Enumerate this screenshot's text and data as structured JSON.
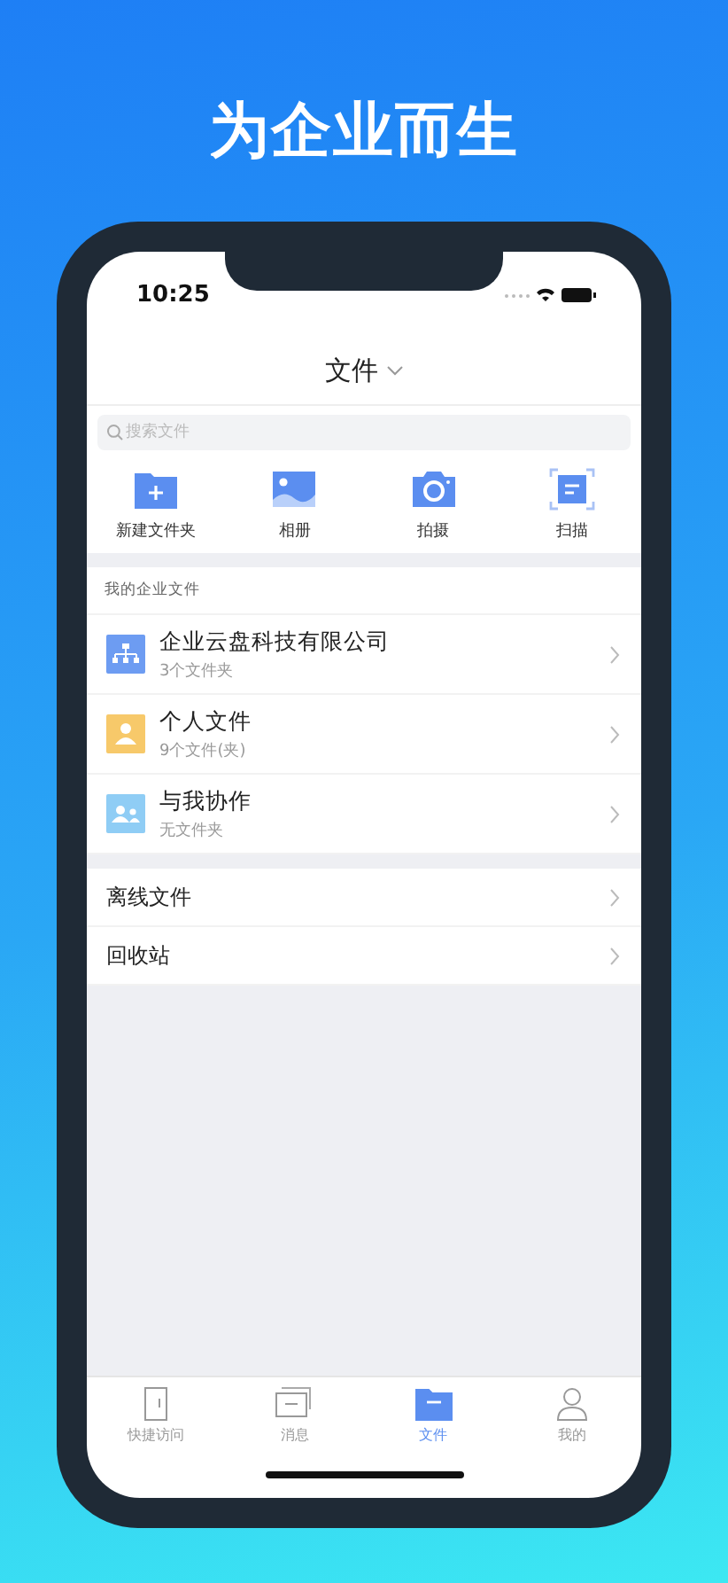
{
  "headline": "为企业而生",
  "status_bar": {
    "time": "10:25"
  },
  "nav": {
    "title": "文件"
  },
  "search": {
    "placeholder": "搜索文件"
  },
  "actions": [
    {
      "kind": "new-folder",
      "label": "新建文件夹"
    },
    {
      "kind": "album",
      "label": "相册"
    },
    {
      "kind": "camera",
      "label": "拍摄"
    },
    {
      "kind": "scan",
      "label": "扫描"
    }
  ],
  "section_title": "我的企业文件",
  "folders": [
    {
      "kind": "company",
      "name": "企业云盘科技有限公司",
      "subtitle": "3个文件夹",
      "color": "#6d9cf2"
    },
    {
      "kind": "personal",
      "name": "个人文件",
      "subtitle": "9个文件(夹)",
      "color": "#f7c96a"
    },
    {
      "kind": "shared",
      "name": "与我协作",
      "subtitle": "无文件夹",
      "color": "#8fcdf5"
    }
  ],
  "links": [
    {
      "label": "离线文件"
    },
    {
      "label": "回收站"
    }
  ],
  "tabs": [
    {
      "kind": "door",
      "label": "快捷访问",
      "selected": false
    },
    {
      "kind": "chat",
      "label": "消息",
      "selected": false
    },
    {
      "kind": "folder",
      "label": "文件",
      "selected": true
    },
    {
      "kind": "person",
      "label": "我的",
      "selected": false
    }
  ]
}
